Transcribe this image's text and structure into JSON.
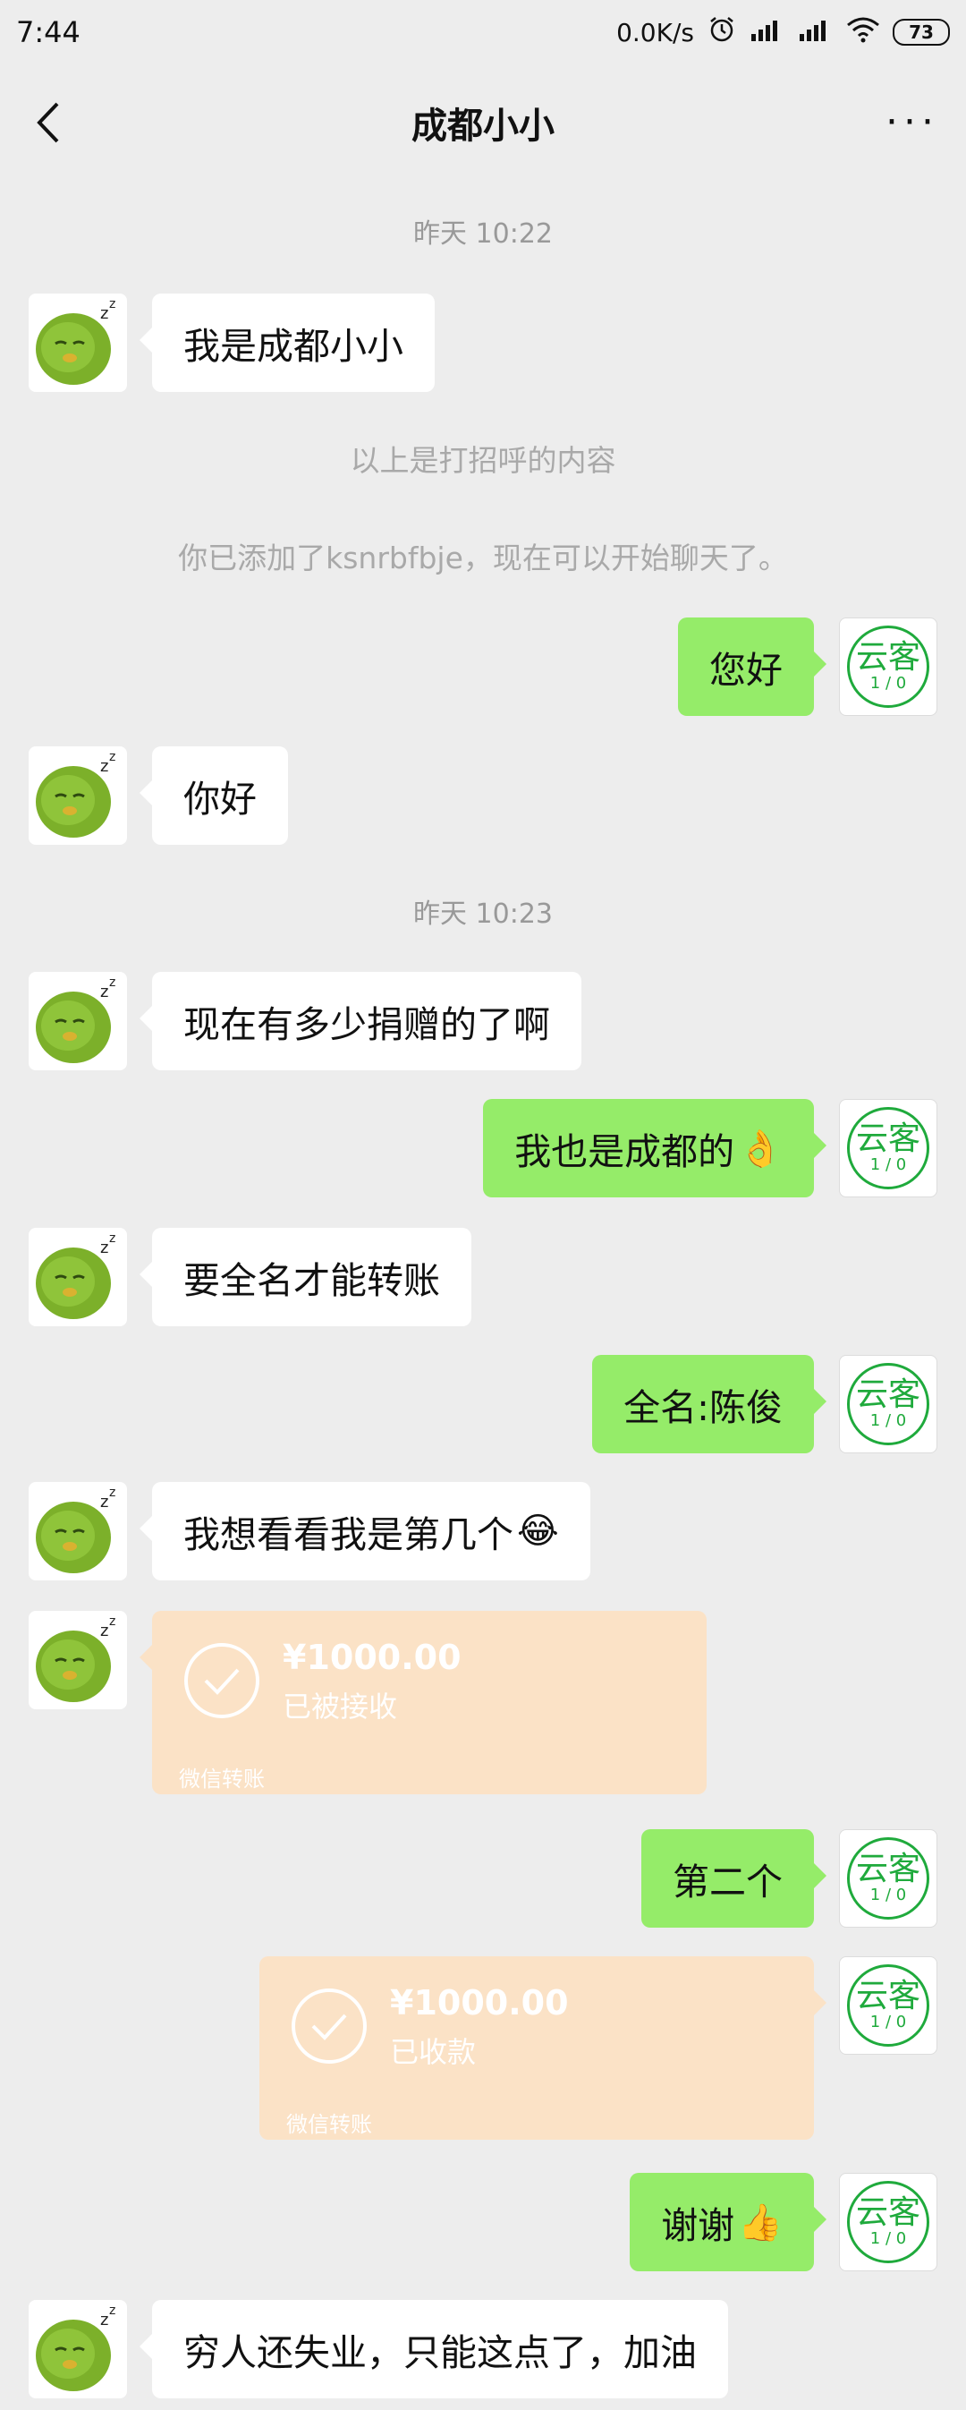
{
  "status_bar": {
    "time": "7:44",
    "network_speed": "0.0K/s",
    "battery": "73"
  },
  "header": {
    "title": "成都小小",
    "more": "···"
  },
  "messages": {
    "time1": "昨天 10:22",
    "m1": "我是成都小小",
    "sys1": "以上是打招呼的内容",
    "sys2": "你已添加了ksnrbfbje，现在可以开始聊天了。",
    "m2": "您好",
    "m3": "你好",
    "time2": "昨天 10:23",
    "m4": "现在有多少捐赠的了啊",
    "m5": "我也是成都的",
    "m5_emoji": "👌",
    "m6": "要全名才能转账",
    "m7": "全名:陈俊",
    "m8": "我想看看我是第几个",
    "m8_emoji": "😂",
    "transfer1": {
      "amount": "¥1000.00",
      "status": "已被接收",
      "label": "微信转账"
    },
    "m9": "第二个",
    "transfer2": {
      "amount": "¥1000.00",
      "status": "已收款",
      "label": "微信转账"
    },
    "m10": "谢谢",
    "m10_emoji": "👍",
    "m11": "穷人还失业，只能这点了，加油"
  },
  "avatar_right": {
    "main": "云客",
    "sub": "1 / 0"
  },
  "colors": {
    "background": "#ededed",
    "sent_bubble": "#95ec69",
    "received_bubble": "#ffffff",
    "transfer_card": "#fbe2c6",
    "brand_green": "#1faa3c"
  }
}
